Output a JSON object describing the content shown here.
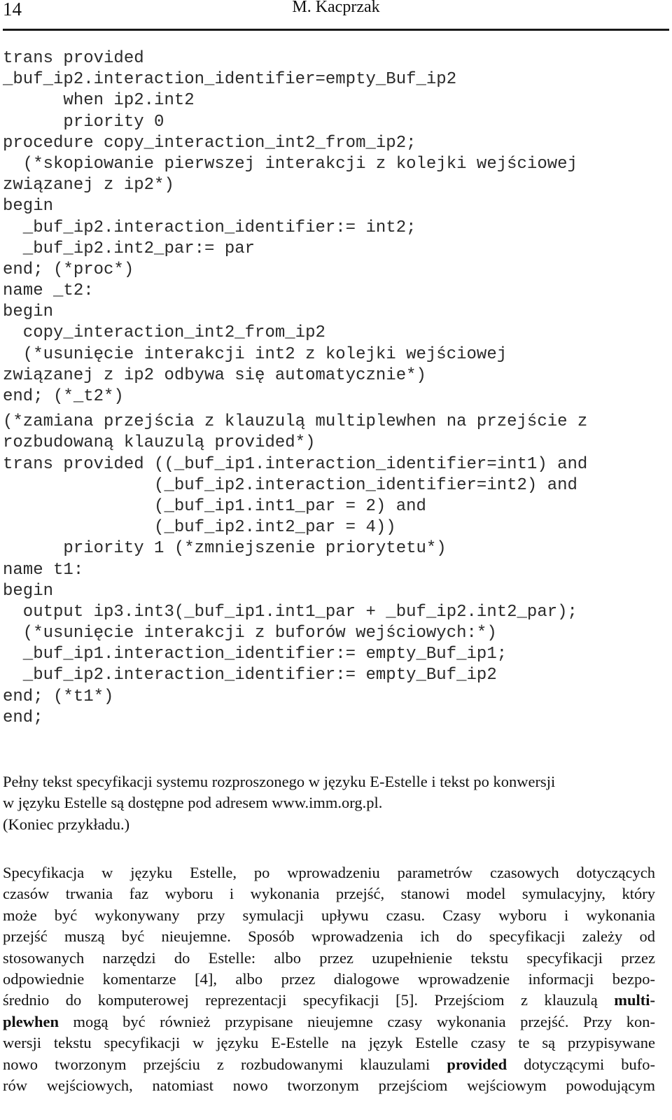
{
  "header": {
    "page_number": "14",
    "running_head": "M. Kacprzak"
  },
  "code": {
    "block1": [
      "trans provided",
      "_buf_ip2.interaction_identifier=empty_Buf_ip2",
      "      when ip2.int2",
      "      priority 0",
      "procedure copy_interaction_int2_from_ip2;",
      "  (*skopiowanie pierwszej interakcji z kolejki wejściowej",
      "związanej z ip2*)",
      "begin",
      "  _buf_ip2.interaction_identifier:= int2;",
      "  _buf_ip2.int2_par:= par",
      "end; (*proc*)",
      "name _t2:",
      "begin",
      "  copy_interaction_int2_from_ip2",
      "  (*usunięcie interakcji int2 z kolejki wejściowej",
      "związanej z ip2 odbywa się automatycznie*)",
      "end; (*_t2*)"
    ],
    "block2": [
      "(*zamiana przejścia z klauzulą multiplewhen na przejście z",
      "rozbudowaną klauzulą provided*)",
      "trans provided ((_buf_ip1.interaction_identifier=int1) and",
      "               (_buf_ip2.interaction_identifier=int2) and",
      "               (_buf_ip1.int1_par = 2) and",
      "               (_buf_ip2.int2_par = 4))",
      "      priority 1 (*zmniejszenie priorytetu*)",
      "name t1:",
      "begin",
      "  output ip3.int3(_buf_ip1.int1_par + _buf_ip2.int2_par);",
      "  (*usunięcie interakcji z buforów wejściowych:*)",
      "  _buf_ip1.interaction_identifier:= empty_Buf_ip1;",
      "  _buf_ip2.interaction_identifier:= empty_Buf_ip2",
      "end; (*t1*)",
      "end;"
    ]
  },
  "paragraph1": {
    "lines": [
      "Pełny tekst specyfikacji systemu rozproszonego w języku E-Estelle i tekst po konwersji",
      "w języku Estelle są dostępne pod adresem www.imm.org.pl.",
      "(Koniec przykładu.)"
    ]
  },
  "paragraph2": {
    "line1": "Specyfikacja w języku Estelle, po wprowadzeniu parametrów czasowych dotyczących",
    "line2": "czasów trwania faz wyboru i wykonania przejść, stanowi model symulacyjny, który",
    "line3": "może być wykonywany przy symulacji upływu czasu. Czasy wyboru i wykonania",
    "line4": "przejść muszą być nieujemne. Sposób wprowadzenia ich do specyfikacji zależy od",
    "line5": "stosowanych narzędzi do Estelle: albo przez uzupełnienie tekstu specyfikacji przez",
    "line6": "odpowiednie komentarze [4], albo przez dialogowe wprowadzenie informacji bezpo-",
    "line7_pre": "średnio do komputerowej reprezentacji specyfikacji [5]. Przejściom z klauzulą ",
    "line7_bold": "multi-",
    "line8_bold": "plewhen",
    "line8_post": " mogą być również przypisane nieujemne czasy wykonania przejść. Przy kon-",
    "line9": "wersji tekstu specyfikacji w języku E-Estelle na język Estelle czasy te są przypisywane",
    "line10_pre": "nowo tworzonym przejściu z rozbudowanymi klauzulami ",
    "line10_bold": "provided",
    "line10_post": " dotyczącymi bufo-",
    "line11": "rów wejściowych, natomiast nowo tworzonym przejściom wejściowym powodującym"
  }
}
